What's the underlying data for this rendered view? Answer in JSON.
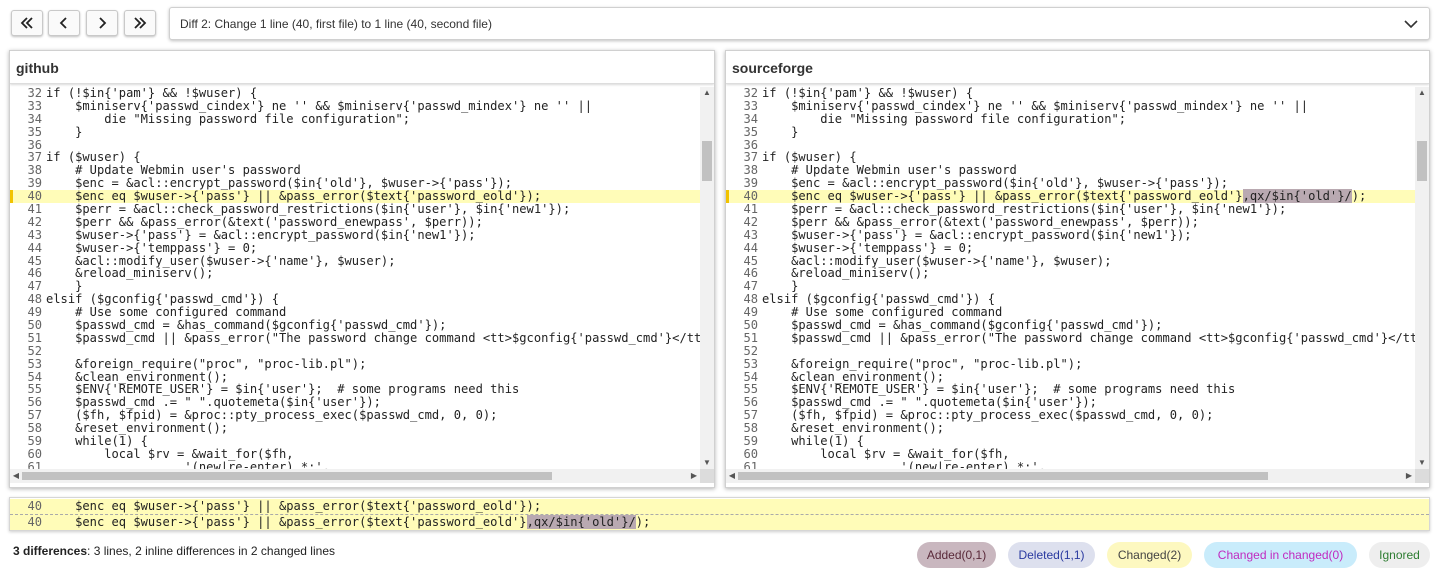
{
  "nav": {
    "first_icon": "double-chevron-left-icon",
    "prev_icon": "chevron-left-icon",
    "next_icon": "chevron-right-icon",
    "last_icon": "double-chevron-right-icon"
  },
  "diff_selector": {
    "value": "Diff 2: Change 1 line (40, first file) to 1 line (40, second file)"
  },
  "left_panel": {
    "title": "github",
    "lines": [
      {
        "n": "32",
        "t": "if (!$in{'pam'} && !$wuser) {"
      },
      {
        "n": "33",
        "t": "    $miniserv{'passwd_cindex'} ne '' && $miniserv{'passwd_mindex'} ne '' ||"
      },
      {
        "n": "34",
        "t": "        die \"Missing password file configuration\";"
      },
      {
        "n": "35",
        "t": "    }"
      },
      {
        "n": "36",
        "t": ""
      },
      {
        "n": "37",
        "t": "if ($wuser) {"
      },
      {
        "n": "38",
        "t": "    # Update Webmin user's password"
      },
      {
        "n": "39",
        "t": "    $enc = &acl::encrypt_password($in{'old'}, $wuser->{'pass'});"
      },
      {
        "n": "40",
        "t": "    $enc eq $wuser->{'pass'} || &pass_error($text{'password_eold'});",
        "changed": true
      },
      {
        "n": "41",
        "t": "    $perr = &acl::check_password_restrictions($in{'user'}, $in{'new1'});"
      },
      {
        "n": "42",
        "t": "    $perr && &pass_error(&text('password_enewpass', $perr));"
      },
      {
        "n": "43",
        "t": "    $wuser->{'pass'} = &acl::encrypt_password($in{'new1'});"
      },
      {
        "n": "44",
        "t": "    $wuser->{'temppass'} = 0;"
      },
      {
        "n": "45",
        "t": "    &acl::modify_user($wuser->{'name'}, $wuser);"
      },
      {
        "n": "46",
        "t": "    &reload_miniserv();"
      },
      {
        "n": "47",
        "t": "    }"
      },
      {
        "n": "48",
        "t": "elsif ($gconfig{'passwd_cmd'}) {"
      },
      {
        "n": "49",
        "t": "    # Use some configured command"
      },
      {
        "n": "50",
        "t": "    $passwd_cmd = &has_command($gconfig{'passwd_cmd'});"
      },
      {
        "n": "51",
        "t": "    $passwd_cmd || &pass_error(\"The password change command <tt>$gconfig{'passwd_cmd'}</tt> was not found\");"
      },
      {
        "n": "52",
        "t": ""
      },
      {
        "n": "53",
        "t": "    &foreign_require(\"proc\", \"proc-lib.pl\");"
      },
      {
        "n": "54",
        "t": "    &clean_environment();"
      },
      {
        "n": "55",
        "t": "    $ENV{'REMOTE_USER'} = $in{'user'};  # some programs need this"
      },
      {
        "n": "56",
        "t": "    $passwd_cmd .= \" \".quotemeta($in{'user'});"
      },
      {
        "n": "57",
        "t": "    ($fh, $fpid) = &proc::pty_process_exec($passwd_cmd, 0, 0);"
      },
      {
        "n": "58",
        "t": "    &reset_environment();"
      },
      {
        "n": "59",
        "t": "    while(1) {"
      },
      {
        "n": "60",
        "t": "        local $rv = &wait_for($fh,"
      },
      {
        "n": "61",
        "t": "                   '(new|re-enter).*:',"
      }
    ]
  },
  "right_panel": {
    "title": "sourceforge",
    "changed_inline": ",qx/$in{'old'}/",
    "lines": [
      {
        "n": "32",
        "t": "if (!$in{'pam'} && !$wuser) {"
      },
      {
        "n": "33",
        "t": "    $miniserv{'passwd_cindex'} ne '' && $miniserv{'passwd_mindex'} ne '' ||"
      },
      {
        "n": "34",
        "t": "        die \"Missing password file configuration\";"
      },
      {
        "n": "35",
        "t": "    }"
      },
      {
        "n": "36",
        "t": ""
      },
      {
        "n": "37",
        "t": "if ($wuser) {"
      },
      {
        "n": "38",
        "t": "    # Update Webmin user's password"
      },
      {
        "n": "39",
        "t": "    $enc = &acl::encrypt_password($in{'old'}, $wuser->{'pass'});"
      },
      {
        "n": "40",
        "t": "    $enc eq $wuser->{'pass'} || &pass_error($text{'password_eold'}",
        "t2": ");",
        "changed": true
      },
      {
        "n": "41",
        "t": "    $perr = &acl::check_password_restrictions($in{'user'}, $in{'new1'});"
      },
      {
        "n": "42",
        "t": "    $perr && &pass_error(&text('password_enewpass', $perr));"
      },
      {
        "n": "43",
        "t": "    $wuser->{'pass'} = &acl::encrypt_password($in{'new1'});"
      },
      {
        "n": "44",
        "t": "    $wuser->{'temppass'} = 0;"
      },
      {
        "n": "45",
        "t": "    &acl::modify_user($wuser->{'name'}, $wuser);"
      },
      {
        "n": "46",
        "t": "    &reload_miniserv();"
      },
      {
        "n": "47",
        "t": "    }"
      },
      {
        "n": "48",
        "t": "elsif ($gconfig{'passwd_cmd'}) {"
      },
      {
        "n": "49",
        "t": "    # Use some configured command"
      },
      {
        "n": "50",
        "t": "    $passwd_cmd = &has_command($gconfig{'passwd_cmd'});"
      },
      {
        "n": "51",
        "t": "    $passwd_cmd || &pass_error(\"The password change command <tt>$gconfig{'passwd_cmd'}</tt> was not found\");"
      },
      {
        "n": "52",
        "t": ""
      },
      {
        "n": "53",
        "t": "    &foreign_require(\"proc\", \"proc-lib.pl\");"
      },
      {
        "n": "54",
        "t": "    &clean_environment();"
      },
      {
        "n": "55",
        "t": "    $ENV{'REMOTE_USER'} = $in{'user'};  # some programs need this"
      },
      {
        "n": "56",
        "t": "    $passwd_cmd .= \" \".quotemeta($in{'user'});"
      },
      {
        "n": "57",
        "t": "    ($fh, $fpid) = &proc::pty_process_exec($passwd_cmd, 0, 0);"
      },
      {
        "n": "58",
        "t": "    &reset_environment();"
      },
      {
        "n": "59",
        "t": "    while(1) {"
      },
      {
        "n": "60",
        "t": "        local $rv = &wait_for($fh,"
      },
      {
        "n": "61",
        "t": "                   '(new|re-enter).*:',"
      }
    ]
  },
  "bottom_compare": {
    "line1_num": "40",
    "line1_text": "    $enc eq $wuser->{'pass'} || &pass_error($text{'password_eold'});",
    "line2_num": "40",
    "line2_text_a": "    $enc eq $wuser->{'pass'} || &pass_error($text{'password_eold'}",
    "line2_inline": ",qx/$in{'old'}/",
    "line2_text_b": ");"
  },
  "summary": {
    "bold": "3 differences",
    "rest": ": 3 lines, 2 inline differences in 2 changed lines"
  },
  "legend": {
    "added": "Added(0,1)",
    "deleted": "Deleted(1,1)",
    "changed": "Changed(2)",
    "changed_in_changed": "Changed in changed(0)",
    "ignored": "Ignored"
  },
  "colors": {
    "changed_bg": "#fffcb8",
    "inline_bg": "#b9a9b1",
    "added_badge": "#c9b7bf",
    "deleted_badge": "#dde0ee",
    "changed_badge": "#fdf8c0",
    "changed_in_changed_badge": "#c9ecfb",
    "ignored_badge": "#eeeeee"
  }
}
